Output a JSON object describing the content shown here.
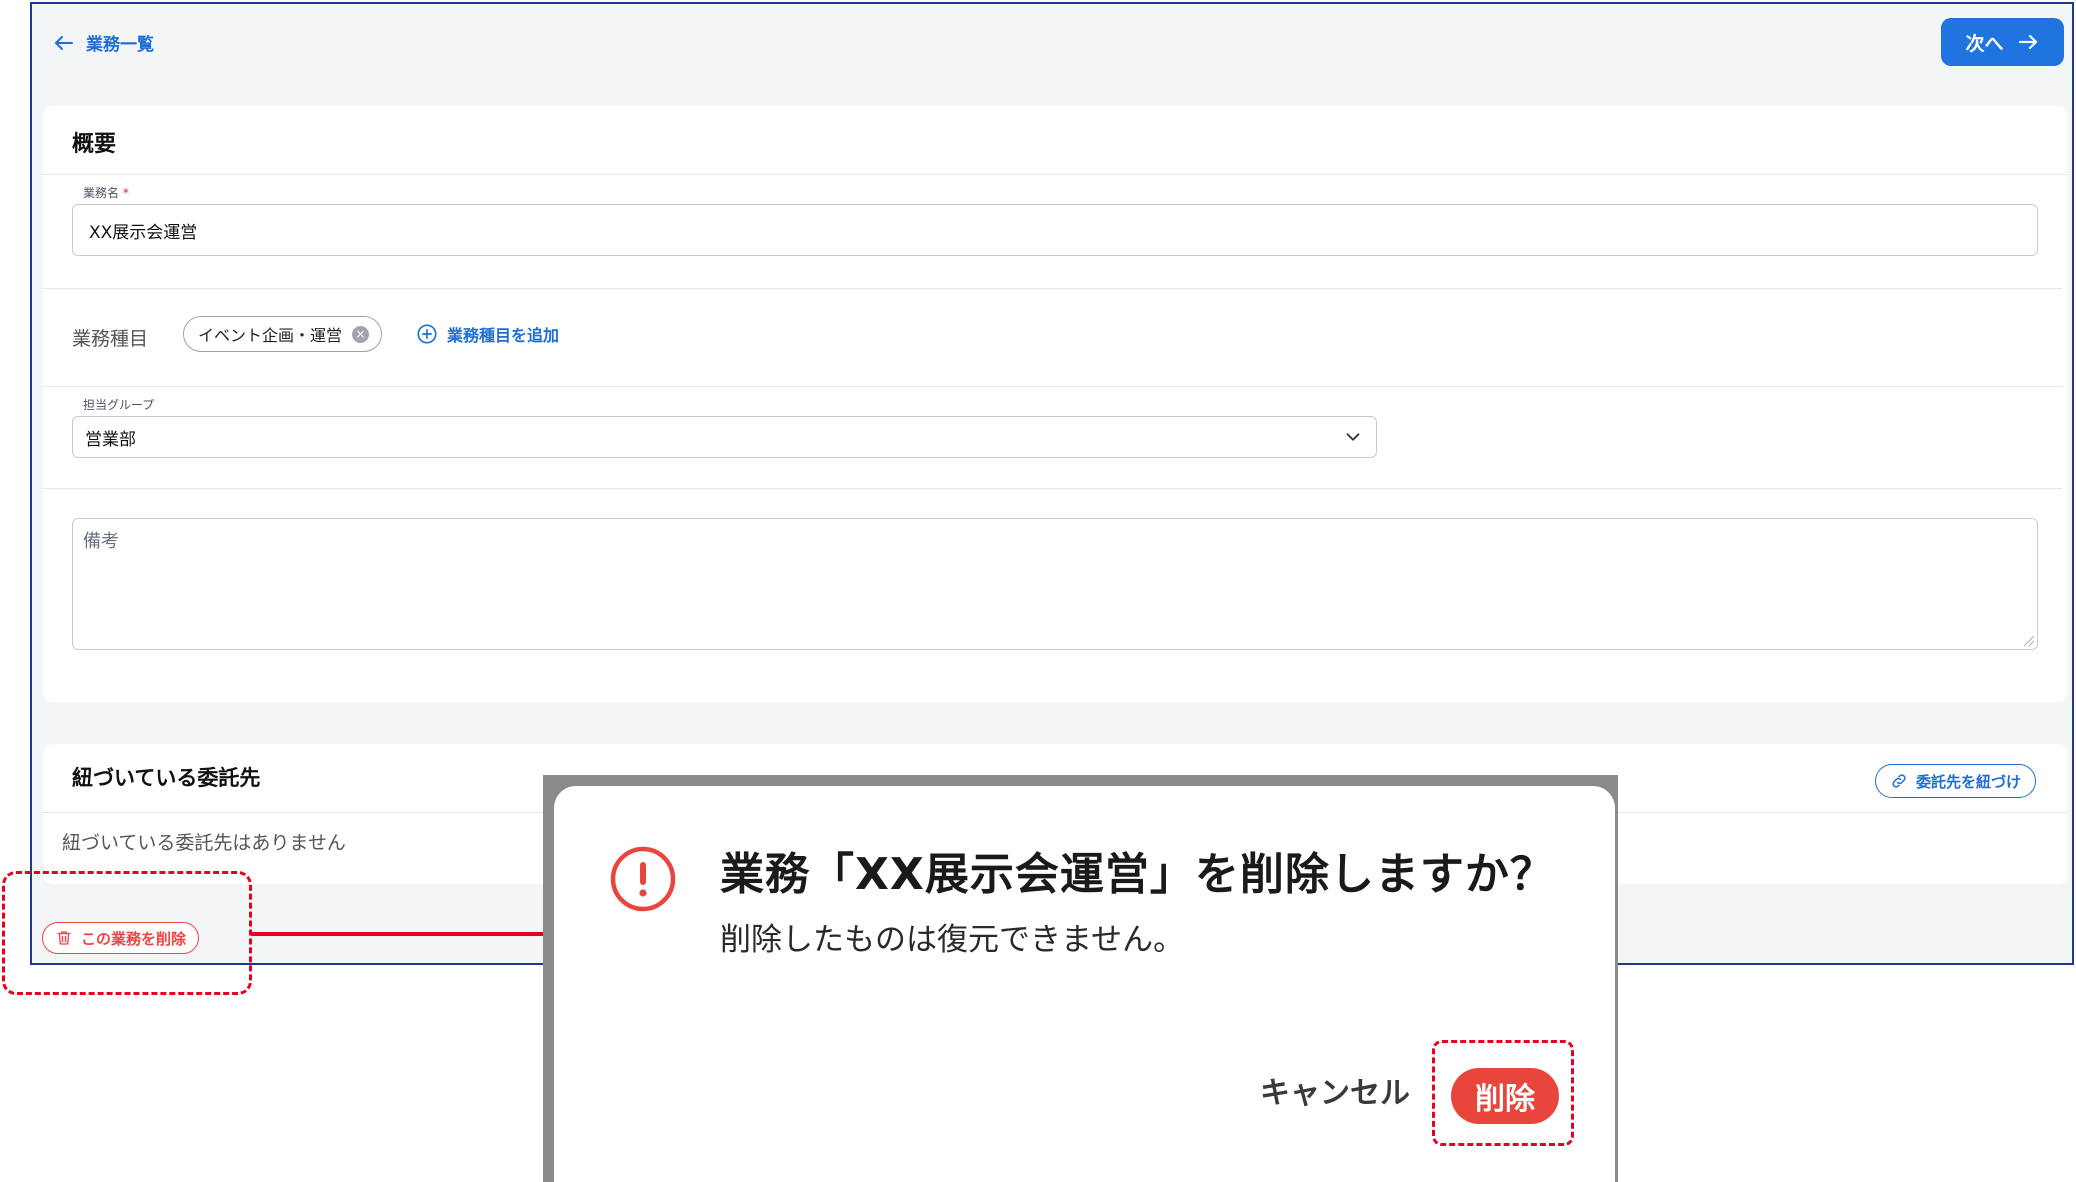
{
  "header": {
    "back_label": "業務一覧",
    "next_label": "次へ"
  },
  "overview": {
    "title": "概要",
    "task_name_label": "業務名",
    "required_mark": "*",
    "task_name_value": "XX展示会運営",
    "category_label": "業務種目",
    "category_chip": "イベント企画・運営",
    "add_category_label": "業務種目を追加",
    "group_label": "担当グループ",
    "group_value": "営業部",
    "notes_placeholder": "備考"
  },
  "vendors": {
    "title": "紐づいている委託先",
    "link_button_label": "委託先を紐づけ",
    "empty_text": "紐づいている委託先はありません"
  },
  "delete_task_label": "この業務を削除",
  "dialog": {
    "title": "業務「XX展示会運営」を削除しますか？",
    "body": "削除したものは復元できません。",
    "cancel_label": "キャンセル",
    "delete_label": "削除"
  },
  "colors": {
    "accent_blue": "#1f74e0",
    "danger_red": "#e8463d",
    "annotation_red": "#e8001c",
    "frame_border": "#1e3a8a"
  }
}
